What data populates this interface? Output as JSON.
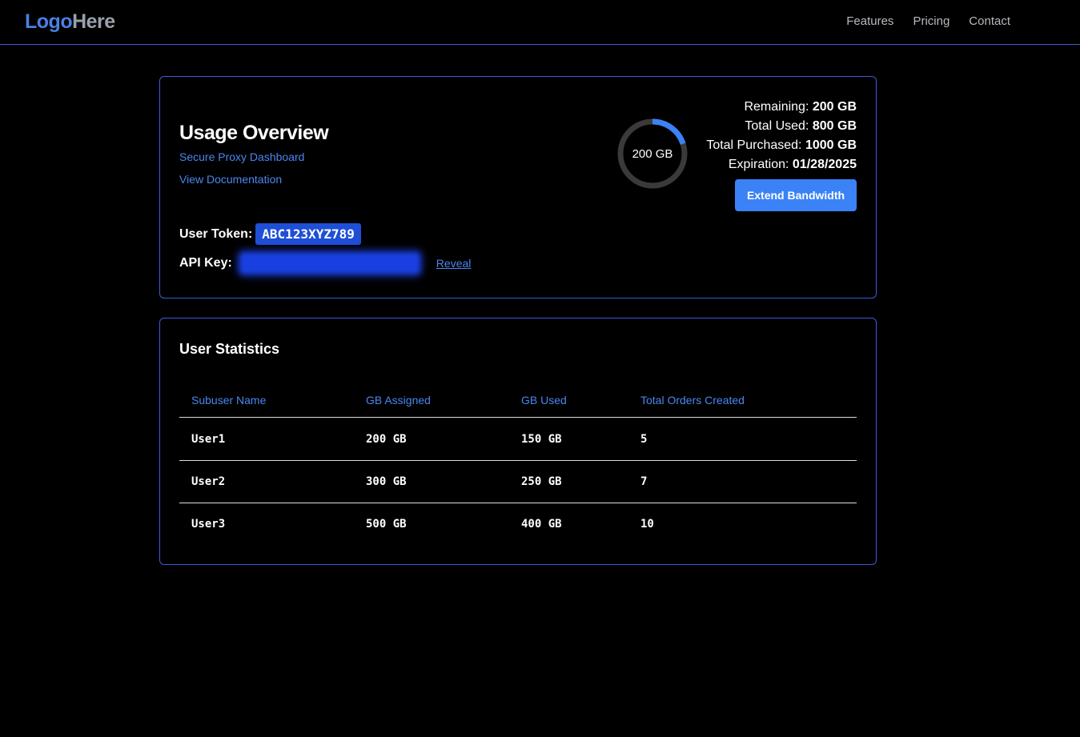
{
  "nav": {
    "logo_part1": "Logo",
    "logo_part2": "Here",
    "links": [
      "Features",
      "Pricing",
      "Contact"
    ]
  },
  "usage": {
    "title": "Usage Overview",
    "subtitle_link": "Secure Proxy Dashboard",
    "doc_link": "View Documentation",
    "token_label": "User Token:",
    "token_value": "ABC123XYZ789",
    "api_label": "API Key:",
    "api_value": "xxxxxxxxxxxxxxxxxxxxxxx",
    "reveal_label": "Reveal",
    "donut_label": "200 GB",
    "donut_remaining_fraction": 0.2,
    "remaining_label": "Remaining:",
    "remaining_value": "200 GB",
    "used_label": "Total Used:",
    "used_value": "800 GB",
    "purchased_label": "Total Purchased:",
    "purchased_value": "1000 GB",
    "expiration_label": "Expiration:",
    "expiration_value": "01/28/2025",
    "extend_button": "Extend Bandwidth"
  },
  "stats": {
    "title": "User Statistics",
    "headers": [
      "Subuser Name",
      "GB Assigned",
      "GB Used",
      "Total Orders Created"
    ],
    "rows": [
      [
        "User1",
        "200 GB",
        "150 GB",
        "5"
      ],
      [
        "User2",
        "300 GB",
        "250 GB",
        "7"
      ],
      [
        "User3",
        "500 GB",
        "400 GB",
        "10"
      ]
    ]
  },
  "colors": {
    "accent": "#3b82f6",
    "border": "#3b5bd6",
    "donut_track": "#3a3a3a"
  }
}
